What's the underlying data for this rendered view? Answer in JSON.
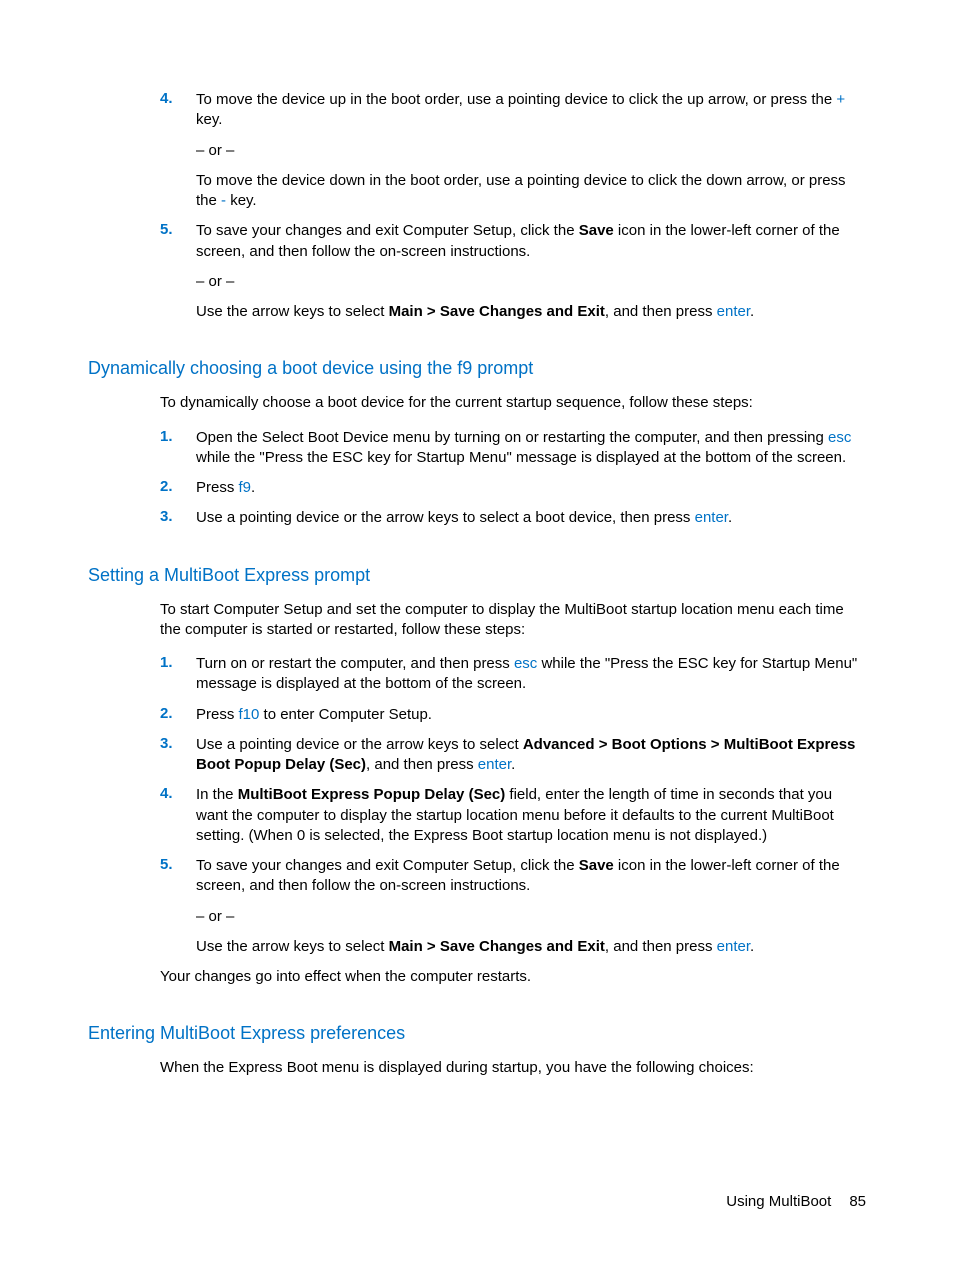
{
  "topItems": {
    "item4": {
      "num": "4.",
      "line1_a": "To move the device up in the boot order, use a pointing device to click the up arrow, or press the ",
      "line1_key": "+",
      "line1_b": " key.",
      "or": "– or –",
      "line2_a": "To move the device down in the boot order, use a pointing device to click the down arrow, or press the ",
      "line2_key": "-",
      "line2_b": " key."
    },
    "item5": {
      "num": "5.",
      "line1_a": "To save your changes and exit Computer Setup, click the ",
      "line1_bold": "Save",
      "line1_b": " icon in the lower-left corner of the screen, and then follow the on-screen instructions.",
      "or": "– or –",
      "line2_a": "Use the arrow keys to select ",
      "line2_bold": "Main > Save Changes and Exit",
      "line2_b": ", and then press ",
      "line2_key": "enter",
      "line2_c": "."
    }
  },
  "section1": {
    "title": "Dynamically choosing a boot device using the f9 prompt",
    "intro": "To dynamically choose a boot device for the current startup sequence, follow these steps:",
    "item1": {
      "num": "1.",
      "a": "Open the Select Boot Device menu by turning on or restarting the computer, and then pressing ",
      "key": "esc",
      "b": " while the \"Press the ESC key for Startup Menu\" message is displayed at the bottom of the screen."
    },
    "item2": {
      "num": "2.",
      "a": "Press ",
      "key": "f9",
      "b": "."
    },
    "item3": {
      "num": "3.",
      "a": "Use a pointing device or the arrow keys to select a boot device, then press ",
      "key": "enter",
      "b": "."
    }
  },
  "section2": {
    "title": "Setting a MultiBoot Express prompt",
    "intro": "To start Computer Setup and set the computer to display the MultiBoot startup location menu each time the computer is started or restarted, follow these steps:",
    "item1": {
      "num": "1.",
      "a": "Turn on or restart the computer, and then press ",
      "key": "esc",
      "b": " while the \"Press the ESC key for Startup Menu\" message is displayed at the bottom of the screen."
    },
    "item2": {
      "num": "2.",
      "a": "Press ",
      "key": "f10",
      "b": " to enter Computer Setup."
    },
    "item3": {
      "num": "3.",
      "a": "Use a pointing device or the arrow keys to select ",
      "bold": "Advanced > Boot Options > MultiBoot Express Boot Popup Delay (Sec)",
      "b": ", and then press ",
      "key": "enter",
      "c": "."
    },
    "item4": {
      "num": "4.",
      "a": "In the ",
      "bold": "MultiBoot Express Popup Delay (Sec)",
      "b": " field, enter the length of time in seconds that you want the computer to display the startup location menu before it defaults to the current MultiBoot setting. (When 0 is selected, the Express Boot startup location menu is not displayed.)"
    },
    "item5": {
      "num": "5.",
      "line1_a": "To save your changes and exit Computer Setup, click the ",
      "line1_bold": "Save",
      "line1_b": " icon in the lower-left corner of the screen, and then follow the on-screen instructions.",
      "or": "– or –",
      "line2_a": "Use the arrow keys to select ",
      "line2_bold": "Main > Save Changes and Exit",
      "line2_b": ", and then press ",
      "line2_key": "enter",
      "line2_c": "."
    },
    "closing": "Your changes go into effect when the computer restarts."
  },
  "section3": {
    "title": "Entering MultiBoot Express preferences",
    "intro": "When the Express Boot menu is displayed during startup, you have the following choices:"
  },
  "footer": {
    "label": "Using MultiBoot",
    "page": "85"
  }
}
